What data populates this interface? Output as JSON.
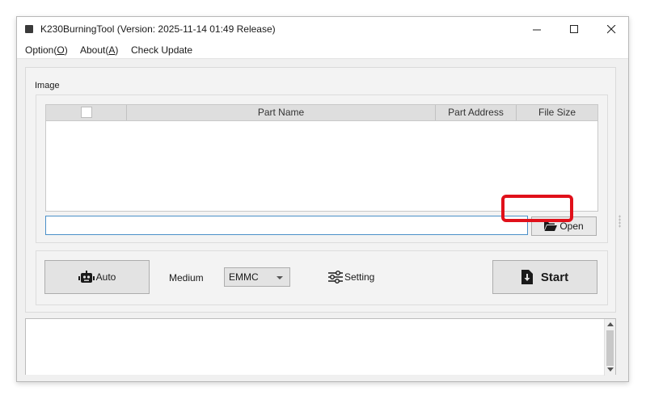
{
  "window": {
    "title": "K230BurningTool (Version: 2025-11-14 01:49 Release)",
    "controls": {
      "minimize": "—",
      "maximize": "☐",
      "close": "✕"
    }
  },
  "menu": {
    "option": {
      "prefix": "Option(",
      "key": "O",
      "suffix": ")"
    },
    "about": {
      "prefix": "About(",
      "key": "A",
      "suffix": ")"
    },
    "check_update": "Check Update"
  },
  "image_section": {
    "label": "Image",
    "columns": {
      "name": "Part Name",
      "address": "Part Address",
      "size": "File Size"
    },
    "rows": [],
    "path_value": "",
    "open_label": "Open"
  },
  "controls": {
    "auto_label": "Auto",
    "medium_label": "Medium",
    "medium_value": "EMMC",
    "setting_label": "Setting",
    "start_label": "Start"
  },
  "log": {
    "text": ""
  },
  "colors": {
    "highlight": "#e0101a",
    "input_border": "#4a90c8"
  },
  "icons": [
    "app-icon",
    "folder-open-icon",
    "robot-icon",
    "sliders-icon",
    "file-download-icon",
    "chevron-down-icon"
  ]
}
